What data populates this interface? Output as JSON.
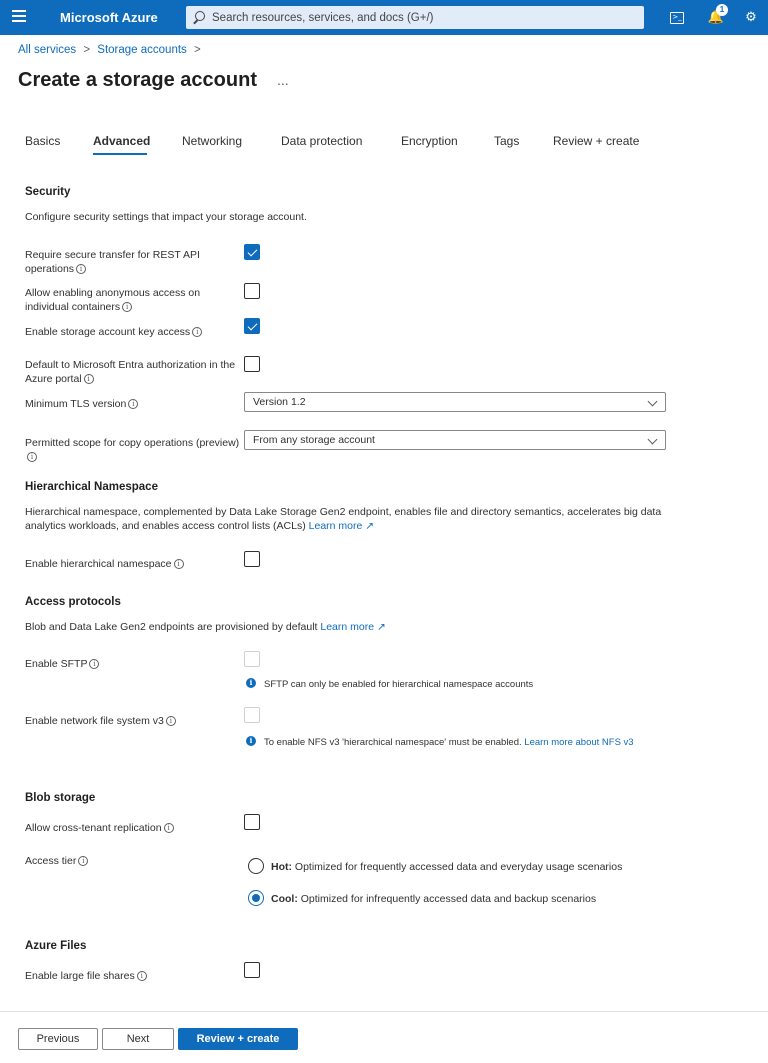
{
  "topbar": {
    "brand": "Microsoft Azure",
    "search_placeholder": "Search resources, services, and docs (G+/)",
    "notification_count": "1"
  },
  "breadcrumb": {
    "item1": "All services",
    "item2": "Storage accounts",
    "sep": ">"
  },
  "page": {
    "title": "Create a storage account",
    "more": "..."
  },
  "tabs": [
    "Basics",
    "Advanced",
    "Networking",
    "Data protection",
    "Encryption",
    "Tags",
    "Review + create"
  ],
  "active_tab": "Advanced",
  "security": {
    "heading": "Security",
    "desc": "Configure security settings that impact your storage account.",
    "secure_transfer": {
      "label": "Require secure transfer for REST API operations",
      "checked": true
    },
    "anonymous_access": {
      "label": "Allow enabling anonymous access on individual containers",
      "checked": false
    },
    "key_access": {
      "label": "Enable storage account key access",
      "checked": true
    },
    "entra_default": {
      "label": "Default to Microsoft Entra authorization in the Azure portal",
      "checked": false
    },
    "tls": {
      "label": "Minimum TLS version",
      "value": "Version 1.2"
    },
    "copy_scope": {
      "label": "Permitted scope for copy operations (preview)",
      "value": "From any storage account"
    }
  },
  "hns": {
    "heading": "Hierarchical Namespace",
    "desc": "Hierarchical namespace, complemented by Data Lake Storage Gen2 endpoint, enables file and directory semantics, accelerates big data analytics workloads, and enables access control lists (ACLs)",
    "learn_more": "Learn more",
    "enable": {
      "label": "Enable hierarchical namespace",
      "checked": false
    }
  },
  "protocols": {
    "heading": "Access protocols",
    "desc": "Blob and Data Lake Gen2 endpoints are provisioned by default",
    "learn_more": "Learn more",
    "sftp": {
      "label": "Enable SFTP",
      "note": "SFTP can only be enabled for hierarchical namespace accounts"
    },
    "nfs": {
      "label": "Enable network file system v3",
      "note": "To enable NFS v3 'hierarchical namespace' must be enabled.",
      "note_link": "Learn more about NFS v3"
    }
  },
  "blob": {
    "heading": "Blob storage",
    "cross_tenant": {
      "label": "Allow cross-tenant replication",
      "checked": false
    },
    "tier": {
      "label": "Access tier",
      "hot_title": "Hot:",
      "hot_desc": "Optimized for frequently accessed data and everyday usage scenarios",
      "cool_title": "Cool:",
      "cool_desc": "Optimized for infrequently accessed data and backup scenarios",
      "selected": "Cool"
    }
  },
  "files": {
    "heading": "Azure Files",
    "large_shares": {
      "label": "Enable large file shares",
      "checked": false
    }
  },
  "footer": {
    "previous": "Previous",
    "next": "Next",
    "review": "Review + create"
  },
  "colors": {
    "accent": "#0f6cbd",
    "text": "#323130"
  }
}
